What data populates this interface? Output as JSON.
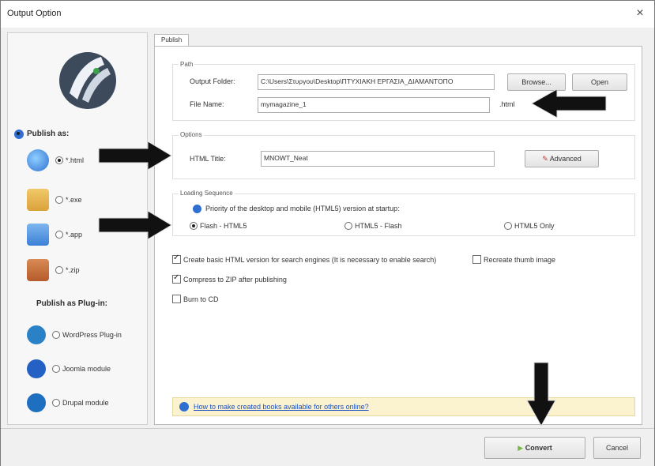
{
  "window": {
    "title": "Output Option",
    "close_glyph": "×"
  },
  "left": {
    "publish_as_label": "Publish as:",
    "options": [
      {
        "label": "*.html",
        "selected": true,
        "icon": "globe-icon",
        "color": "#2f6fd1"
      },
      {
        "label": "*.exe",
        "selected": false,
        "icon": "box-icon",
        "color": "#d9a23a"
      },
      {
        "label": "*.app",
        "selected": false,
        "icon": "mac-icon",
        "color": "#3b7fd6"
      },
      {
        "label": "*.zip",
        "selected": false,
        "icon": "book-icon",
        "color": "#b65b2c"
      }
    ],
    "plugin_label": "Publish as Plug-in:",
    "plugins": [
      {
        "label": "WordPress Plug-in",
        "icon": "wordpress-icon",
        "color": "#2a81c6"
      },
      {
        "label": "Joomla module",
        "icon": "joomla-icon",
        "color": "#2560c4"
      },
      {
        "label": "Drupal module",
        "icon": "drupal-icon",
        "color": "#1f6fc0"
      }
    ]
  },
  "tabs": {
    "publish": "Publish"
  },
  "path": {
    "group_title": "Path",
    "output_folder_label": "Output Folder:",
    "output_folder_value": "C:\\Users\\Στυργου\\Desktop\\ΠΤΥΧΙΑΚΗ ΕΡΓΑΣΙΑ_ΔΙΑΜΑΝΤΟΠΟ",
    "browse_label": "Browse...",
    "open_label": "Open",
    "file_name_label": "File Name:",
    "file_name_value": "mymagazine_1",
    "extension": ".html"
  },
  "options": {
    "group_title": "Options",
    "html_title_label": "HTML Title:",
    "html_title_value": "MNOWT_Neat",
    "advanced_label": "Advanced"
  },
  "loading": {
    "group_title": "Loading Sequence",
    "priority_text": "Priority of the desktop and mobile (HTML5) version at startup:",
    "choices": [
      {
        "label": "Flash - HTML5",
        "selected": true
      },
      {
        "label": "HTML5 - Flash",
        "selected": false
      },
      {
        "label": "HTML5 Only",
        "selected": false
      }
    ]
  },
  "checks": {
    "create_basic": {
      "label": "Create basic HTML version for search engines (It is necessary to enable search)",
      "checked": true
    },
    "recreate_thumb": {
      "label": "Recreate thumb image",
      "checked": false
    },
    "compress_zip": {
      "label": "Compress to ZIP after publishing",
      "checked": true
    },
    "burn_cd": {
      "label": "Burn to CD",
      "checked": false
    }
  },
  "info": {
    "link_text": "How to make created books available for others online?"
  },
  "bottom": {
    "convert_label": "Convert",
    "cancel_label": "Cancel"
  },
  "colors": {
    "accent": "#2f6fd1",
    "info_bg": "#fbf3cf",
    "arrow": "#111111"
  }
}
